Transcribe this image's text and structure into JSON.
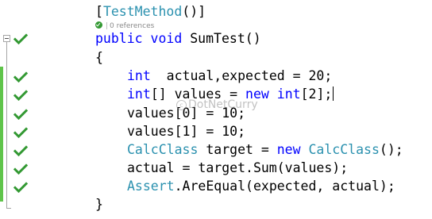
{
  "colors": {
    "keyword": "#0000ff",
    "type": "#2b91af",
    "text": "#000000",
    "check_green": "#339933",
    "change_bar": "#5fc44a",
    "codelens": "#8a8a8a"
  },
  "codelens": {
    "status_icon": "test-passed-icon",
    "references": "0 references"
  },
  "watermark": "DotNetCurry",
  "code": {
    "l0": {
      "p1": "[",
      "type": "TestMethod",
      "p2": "()]"
    },
    "l1": {
      "kw1": "public",
      "kw2": "void",
      "rest": "SumTest()"
    },
    "l2": {
      "text": "{"
    },
    "l3": {
      "kw": "int",
      "rest": "  actual,expected = 20;"
    },
    "l4": {
      "kw1": "int",
      "p1": "[] values = ",
      "kw2": "new",
      "sp": " ",
      "kw3": "int",
      "p2": "[2];"
    },
    "l5": {
      "text": "values[0] = 10;"
    },
    "l6": {
      "text": "values[1] = 10;"
    },
    "l7": {
      "type1": "CalcClass",
      "p1": " target = ",
      "kw": "new",
      "sp": " ",
      "type2": "CalcClass",
      "p2": "();"
    },
    "l8": {
      "text": "actual = target.Sum(values);"
    },
    "l9": {
      "type": "Assert",
      "p1": ".AreEqual(expected, actual);"
    },
    "l10": {
      "text": "}"
    }
  },
  "gutter_icons": [
    "test-passed-check-icon"
  ]
}
